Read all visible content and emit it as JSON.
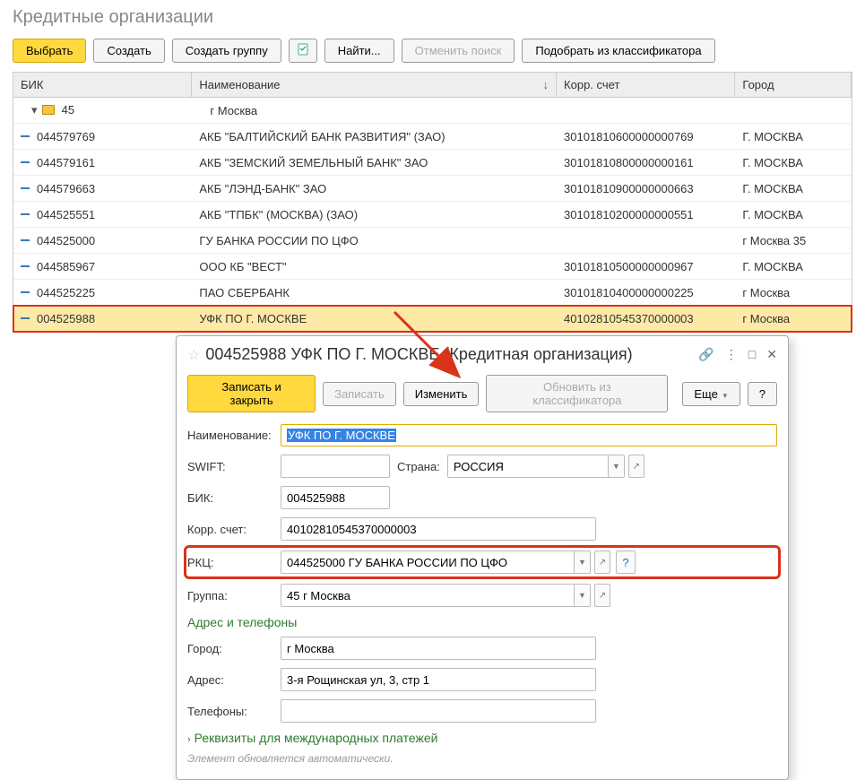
{
  "page_title": "Кредитные организации",
  "toolbar": {
    "select": "Выбрать",
    "create": "Создать",
    "create_group": "Создать группу",
    "find": "Найти...",
    "cancel_search": "Отменить поиск",
    "pick_from_classifier": "Подобрать из классификатора"
  },
  "columns": {
    "bik": "БИК",
    "name": "Наименование",
    "korr": "Корр. счет",
    "city": "Город"
  },
  "group": {
    "code": "45",
    "name": "г Москва"
  },
  "rows": [
    {
      "bik": "044579769",
      "name": "АКБ \"БАЛТИЙСКИЙ БАНК РАЗВИТИЯ\" (ЗАО)",
      "korr": "30101810600000000769",
      "city": "Г. МОСКВА"
    },
    {
      "bik": "044579161",
      "name": "АКБ \"ЗЕМСКИЙ ЗЕМЕЛЬНЫЙ БАНК\" ЗАО",
      "korr": "30101810800000000161",
      "city": "Г. МОСКВА"
    },
    {
      "bik": "044579663",
      "name": "АКБ \"ЛЭНД-БАНК\" ЗАО",
      "korr": "30101810900000000663",
      "city": "Г. МОСКВА"
    },
    {
      "bik": "044525551",
      "name": "АКБ \"ТПБК\" (МОСКВА) (ЗАО)",
      "korr": "30101810200000000551",
      "city": "Г. МОСКВА"
    },
    {
      "bik": "044525000",
      "name": "ГУ БАНКА РОССИИ ПО ЦФО",
      "korr": "",
      "city": "г Москва 35"
    },
    {
      "bik": "044585967",
      "name": "ООО КБ \"ВЕСТ\"",
      "korr": "30101810500000000967",
      "city": "Г. МОСКВА"
    },
    {
      "bik": "044525225",
      "name": "ПАО СБЕРБАНК",
      "korr": "30101810400000000225",
      "city": "г Москва"
    },
    {
      "bik": "004525988",
      "name": "УФК ПО Г. МОСКВЕ",
      "korr": "40102810545370000003",
      "city": "г Москва",
      "selected": true
    }
  ],
  "modal": {
    "title": "004525988 УФК ПО Г. МОСКВЕ (Кредитная организация)",
    "toolbar": {
      "save_close": "Записать и закрыть",
      "save": "Записать",
      "edit": "Изменить",
      "refresh": "Обновить из классификатора",
      "more": "Еще",
      "help": "?"
    },
    "labels": {
      "name": "Наименование:",
      "swift": "SWIFT:",
      "country": "Страна:",
      "bik": "БИК:",
      "korr": "Корр. счет:",
      "rkc": "РКЦ:",
      "group": "Группа:",
      "section_addr": "Адрес и телефоны",
      "city": "Город:",
      "addr": "Адрес:",
      "tel": "Телефоны:",
      "expander": "Реквизиты для международных платежей",
      "footer": "Элемент обновляется автоматически."
    },
    "values": {
      "name": "УФК ПО Г. МОСКВЕ",
      "swift": "",
      "country": "РОССИЯ",
      "bik": "004525988",
      "korr": "40102810545370000003",
      "rkc": "044525000 ГУ БАНКА РОССИИ ПО ЦФО",
      "group": "45 г Москва",
      "city": "г Москва",
      "addr": "3-я Рощинская ул, 3, стр 1",
      "tel": ""
    }
  }
}
